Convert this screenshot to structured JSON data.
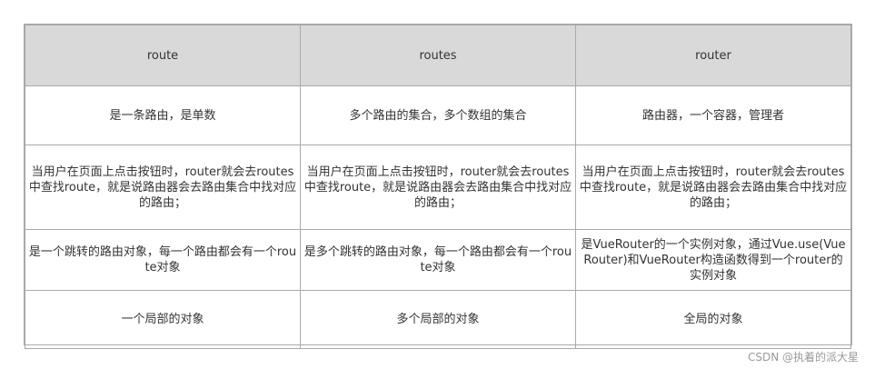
{
  "table": {
    "headers": [
      "route",
      "routes",
      "router"
    ],
    "rows": [
      [
        "是一条路由，是单数",
        "多个路由的集合，多个数组的集合",
        "路由器，一个容器，管理者"
      ],
      [
        "当用户在页面上点击按钮时，router就会去routes中查找route，就是说路由器会去路由集合中找对应的路由；",
        "当用户在页面上点击按钮时，router就会去routes中查找route，就是说路由器会去路由集合中找对应的路由；",
        "当用户在页面上点击按钮时，router就会去routes中查找route，就是说路由器会去路由集合中找对应的路由；"
      ],
      [
        "是一个跳转的路由对象，每一个路由都会有一个route对象",
        "是多个跳转的路由对象，每一个路由都会有一个route对象",
        "是VueRouter的一个实例对象，通过Vue.use(VueRouter)和VueRouter构造函数得到一个router的实例对象"
      ],
      [
        "一个局部的对象",
        "多个局部的对象",
        "全局的对象"
      ]
    ]
  },
  "watermark": "CSDN @执着的派大星"
}
